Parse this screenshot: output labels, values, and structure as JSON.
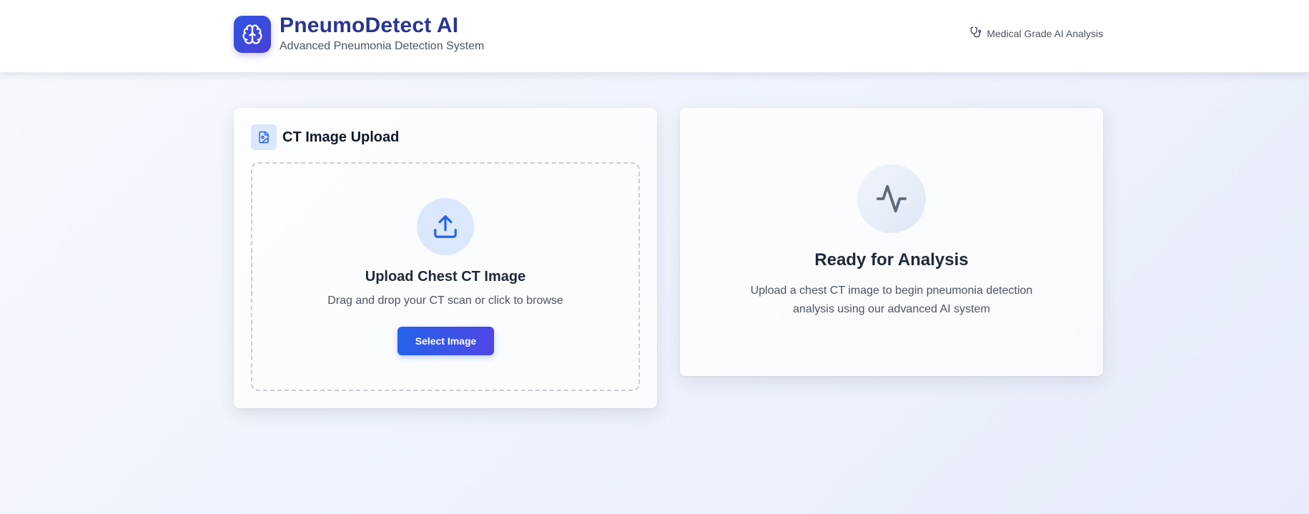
{
  "header": {
    "title": "PneumoDetect AI",
    "subtitle": "Advanced Pneumonia Detection System",
    "badge_label": "Medical Grade AI Analysis",
    "logo_icon": "brain-icon",
    "badge_icon": "stethoscope-icon"
  },
  "upload_card": {
    "title": "CT Image Upload",
    "title_icon": "file-image-icon",
    "dropzone": {
      "icon": "upload-icon",
      "heading": "Upload Chest CT Image",
      "description": "Drag and drop your CT scan or click to browse",
      "button_label": "Select Image"
    }
  },
  "status_card": {
    "icon": "activity-icon",
    "heading": "Ready for Analysis",
    "description": "Upload a chest CT image to begin pneumonia detection analysis using our advanced AI system"
  },
  "colors": {
    "brand": "#283593",
    "accent_start": "#2563eb",
    "accent_end": "#4f46e5",
    "icon_bg": "#dbe7fb"
  }
}
